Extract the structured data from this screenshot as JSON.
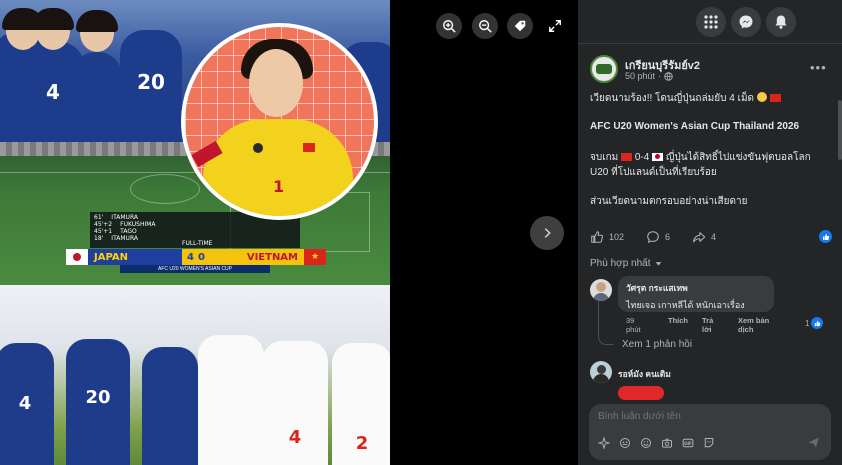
{
  "viewer": {
    "controls": [
      "zoom-in-icon",
      "zoom-out-icon",
      "tag-icon",
      "fullscreen-icon"
    ],
    "scoreboard": {
      "lines": [
        {
          "min": "61'",
          "name": "ITAMURA"
        },
        {
          "min": "45'+2",
          "name": "FUKUSHIMA"
        },
        {
          "min": "45'+1",
          "name": "TAGO"
        },
        {
          "min": "18'",
          "name": "ITAMURA"
        }
      ],
      "status": "FULL-TIME",
      "team_home": "JAPAN",
      "score_home": "4",
      "score_away": "0",
      "team_away": "VIETNAM",
      "competition": "AFC U20 WOMEN'S ASIAN CUP"
    },
    "jersey_numbers": {
      "top": [
        "4",
        "20"
      ],
      "gk": "1",
      "bottom": [
        "4",
        "20",
        "4",
        "2"
      ]
    }
  },
  "header": {
    "icons": [
      "grid-menu-icon",
      "messenger-icon",
      "notifications-bell-icon"
    ]
  },
  "post": {
    "page_name": "เกรียนบุรีรัมย์v2",
    "time": "50 phút",
    "line1": "เวียดนามร้อง!! โดนญี่ปุ่นถล่มยับ 4 เม็ด",
    "line2": "AFC U20 Women's Asian Cup Thailand 2026",
    "line3a_pre": "จบเกม",
    "line3a_mid": "0-4",
    "line3a_post": "ญี่ปุ่นได้สิทธิ์ไปแข่งขันฟุตบอลโลก",
    "line3b": "U20 ที่โปแลนด์เป็นที่เรียบร้อย",
    "line4": "ส่วนเวียดนามตกรอบอย่างน่าเสียดาย",
    "likes": "102",
    "comments": "6",
    "shares": "4"
  },
  "comments": {
    "sort_label": "Phù hợp nhất",
    "first": {
      "name": "วัศรุต กระแสเทพ",
      "text": "ไทยเจอ เกาหลีได้ หนักเอาเรื่อง",
      "time_line1": "39",
      "time_line2": "phút",
      "like": "Thích",
      "reply_line1": "Trả",
      "reply_line2": "lời",
      "translate_line1": "Xem bản",
      "translate_line2": "dịch",
      "reaction_count": "1"
    },
    "view_replies": "Xem 1 phản hồi",
    "second": {
      "name": "รอห์มัง คนเดิม"
    },
    "composer_placeholder": "Bình luận dưới tên"
  },
  "colors": {
    "panel_bg": "#242526",
    "bubble_bg": "#3a3b3c",
    "text_primary": "#e4e6eb",
    "text_secondary": "#b0b3b8",
    "accent_blue": "#1877f2",
    "japan_blue": "#1e3fa0",
    "vietnam_red": "#da251d",
    "gk_yellow": "#f2d21c"
  }
}
